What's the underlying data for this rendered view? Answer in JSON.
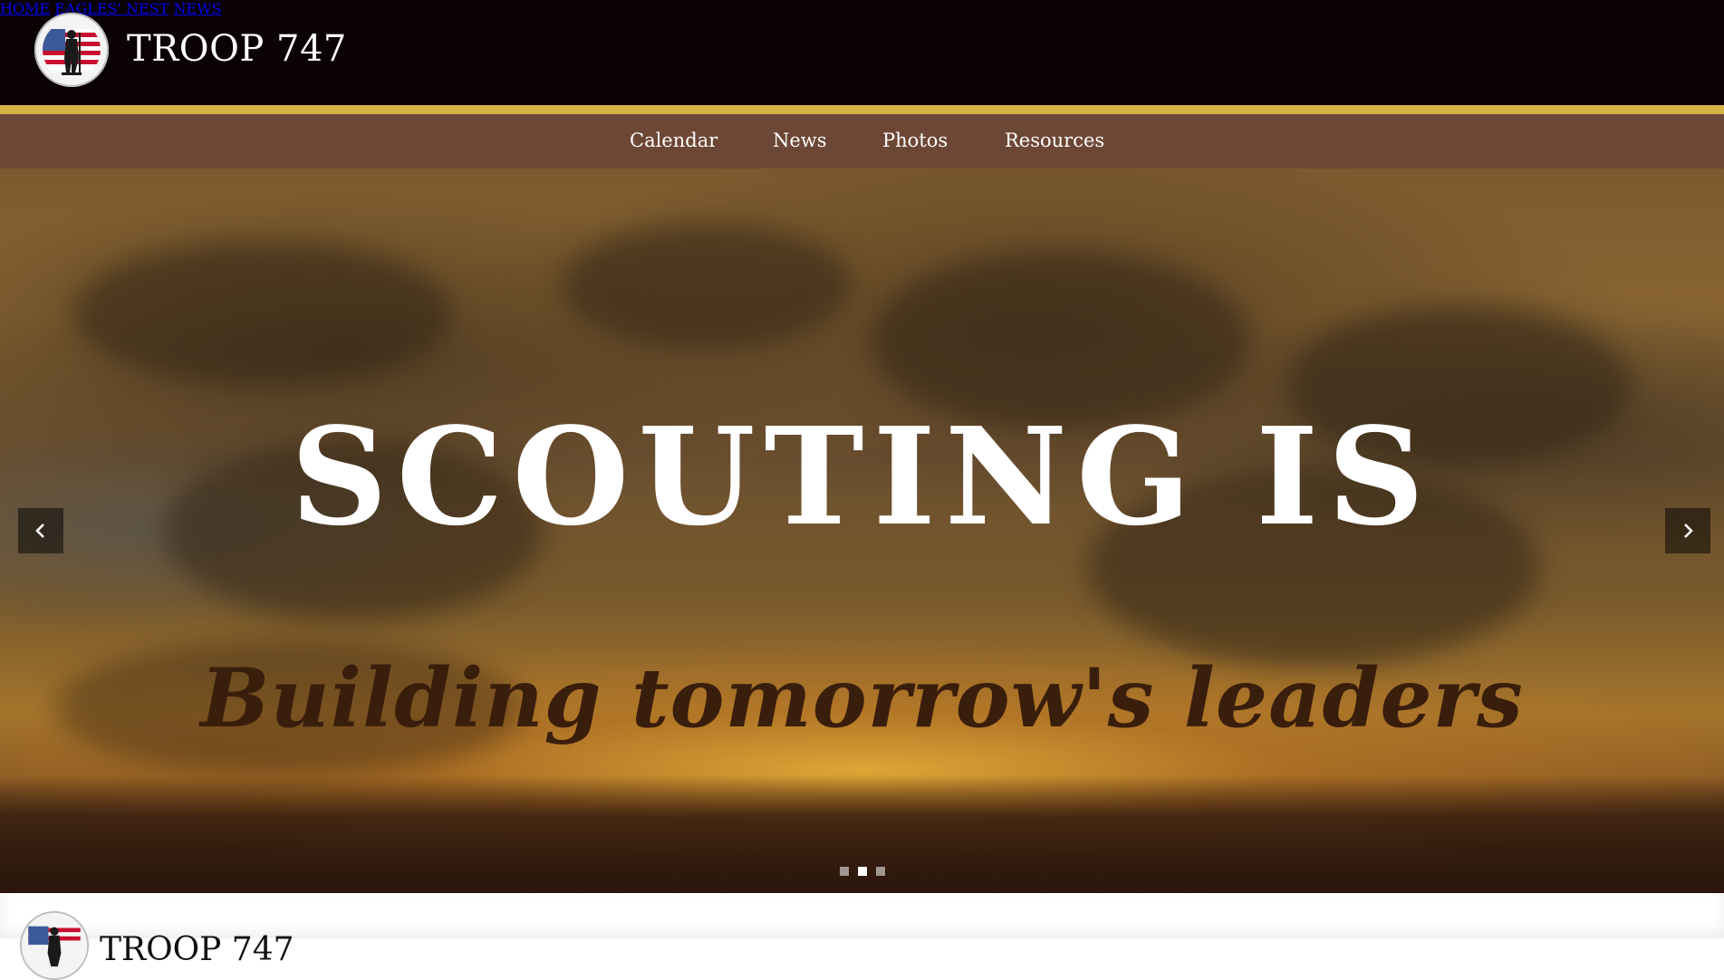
{
  "header": {
    "brand": "TROOP 747",
    "logo_icon": "troop-seal-icon",
    "nav": [
      "HOME",
      "EAGLES' NEST",
      "NEWS"
    ],
    "background": "#0b0203",
    "accent_line": "#d4b344"
  },
  "subnav": {
    "items": [
      "Calendar",
      "News",
      "Photos",
      "Resources"
    ],
    "background": "#6d4735"
  },
  "hero": {
    "title": "SCOUTING IS",
    "subtitle": "Building tomorrow's leaders",
    "prev_icon": "chevron-left-icon",
    "next_icon": "chevron-right-icon",
    "slides_count": 3,
    "active_slide": 2
  },
  "secondary_header": {
    "brand": "TROOP 747"
  }
}
